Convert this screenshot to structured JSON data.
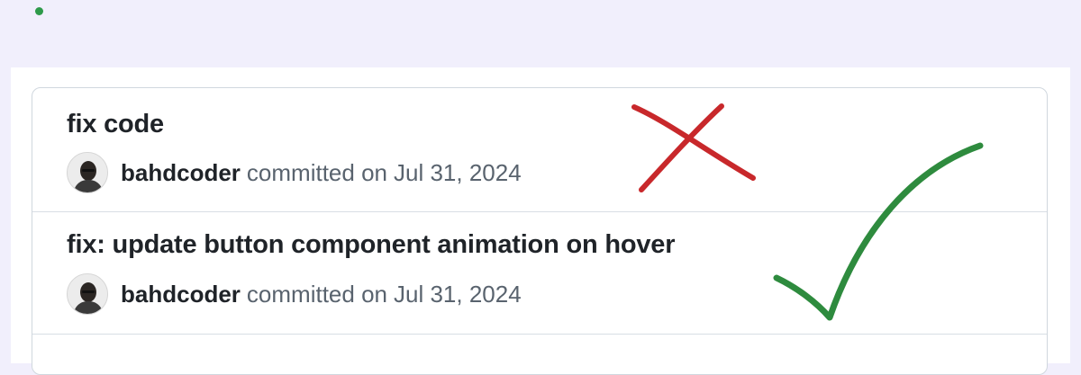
{
  "commits": [
    {
      "title": "fix code",
      "author": "bahdcoder",
      "action": "committed on",
      "date": "Jul 31, 2024",
      "verdict": "cross-mark-icon"
    },
    {
      "title": "fix: update button component animation on hover",
      "author": "bahdcoder",
      "action": "committed on",
      "date": "Jul 31, 2024",
      "verdict": "check-mark-icon"
    }
  ],
  "colors": {
    "page_background": "#f1effc",
    "cross": "#c8282b",
    "check": "#2e8b3e",
    "dot": "#2e9a4a",
    "title_text": "#1f2328",
    "muted_text": "#59636e",
    "border": "#d0d7de"
  }
}
